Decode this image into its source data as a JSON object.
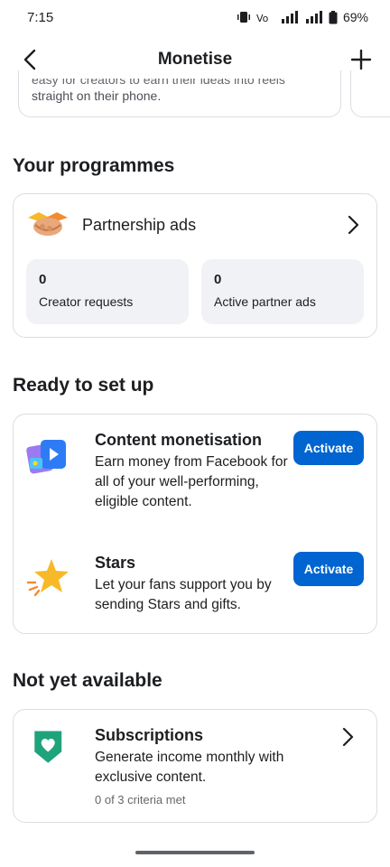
{
  "status_bar": {
    "time": "7:15",
    "battery": "69%"
  },
  "header": {
    "title": "Monetise",
    "back_icon": "chevron-left-icon",
    "add_icon": "plus-icon"
  },
  "previous_card": {
    "cut_text": "easy for creators to earn their ideas into reels",
    "text": "straight on their phone."
  },
  "your_programmes": {
    "title": "Your programmes",
    "partnership": {
      "label": "Partnership ads",
      "icon": "handshake-icon",
      "stats": [
        {
          "value": "0",
          "label": "Creator requests"
        },
        {
          "value": "0",
          "label": "Active partner ads"
        }
      ]
    }
  },
  "ready": {
    "title": "Ready to set up",
    "items": [
      {
        "title": "Content monetisation",
        "description": "Earn money from Facebook for all of your well-performing, eligible content.",
        "button": "Activate",
        "icon": "video-photo-icon"
      },
      {
        "title": "Stars",
        "description": "Let your fans support you by sending Stars and gifts.",
        "button": "Activate",
        "icon": "star-icon"
      }
    ]
  },
  "not_available": {
    "title": "Not yet available",
    "subscriptions": {
      "title": "Subscriptions",
      "description": "Generate income monthly with exclusive content.",
      "meta": "0 of 3 criteria met",
      "icon": "heart-badge-icon"
    }
  },
  "colors": {
    "accent": "#0064d1",
    "card_border": "#dadde1",
    "stat_bg": "#f0f2f5"
  }
}
